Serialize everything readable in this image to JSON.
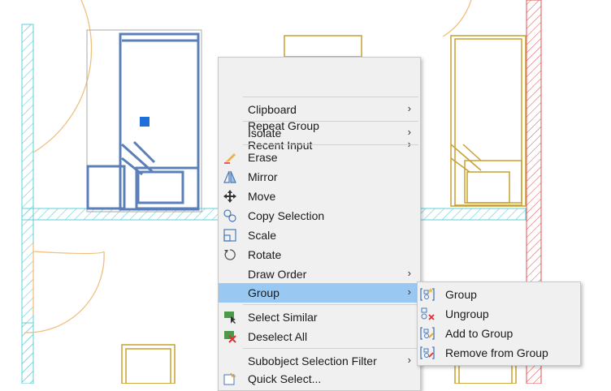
{
  "context_menu": {
    "items": [
      {
        "label": "Repeat Group",
        "icon": "",
        "submenu": false
      },
      {
        "label": "Recent Input",
        "icon": "",
        "submenu": true
      },
      {
        "label": "Clipboard",
        "icon": "",
        "submenu": true
      },
      {
        "label": "Isolate",
        "icon": "",
        "submenu": true
      },
      {
        "label": "Erase",
        "icon": "erase-icon",
        "submenu": false
      },
      {
        "label": "Mirror",
        "icon": "mirror-icon",
        "submenu": false
      },
      {
        "label": "Move",
        "icon": "move-icon",
        "submenu": false
      },
      {
        "label": "Copy Selection",
        "icon": "copy-selection-icon",
        "submenu": false
      },
      {
        "label": "Scale",
        "icon": "scale-icon",
        "submenu": false
      },
      {
        "label": "Rotate",
        "icon": "rotate-icon",
        "submenu": false
      },
      {
        "label": "Draw Order",
        "icon": "",
        "submenu": true
      },
      {
        "label": "Group",
        "icon": "",
        "submenu": true,
        "highlighted": true
      },
      {
        "label": "Select Similar",
        "icon": "select-similar-icon",
        "submenu": false
      },
      {
        "label": "Deselect All",
        "icon": "deselect-all-icon",
        "submenu": false
      },
      {
        "label": "Subobject Selection Filter",
        "icon": "",
        "submenu": true
      },
      {
        "label": "Quick Select...",
        "icon": "quick-select-icon",
        "submenu": false
      }
    ],
    "arrow_glyph": "›"
  },
  "group_submenu": {
    "items": [
      {
        "label": "Group",
        "icon": "group-icon"
      },
      {
        "label": "Ungroup",
        "icon": "ungroup-icon"
      },
      {
        "label": "Add to Group",
        "icon": "add-to-group-icon"
      },
      {
        "label": "Remove from Group",
        "icon": "remove-from-group-icon"
      }
    ]
  },
  "colors": {
    "menu_bg": "#f0f0f0",
    "highlight": "#99c9f3",
    "selected_geometry": "#5b7fb8",
    "grip": "#1e6fd9",
    "furniture": "#c8a030",
    "wall_hatch": "#5fd0d8",
    "wall_red": "#e05050",
    "door_arc": "#f0c080"
  }
}
